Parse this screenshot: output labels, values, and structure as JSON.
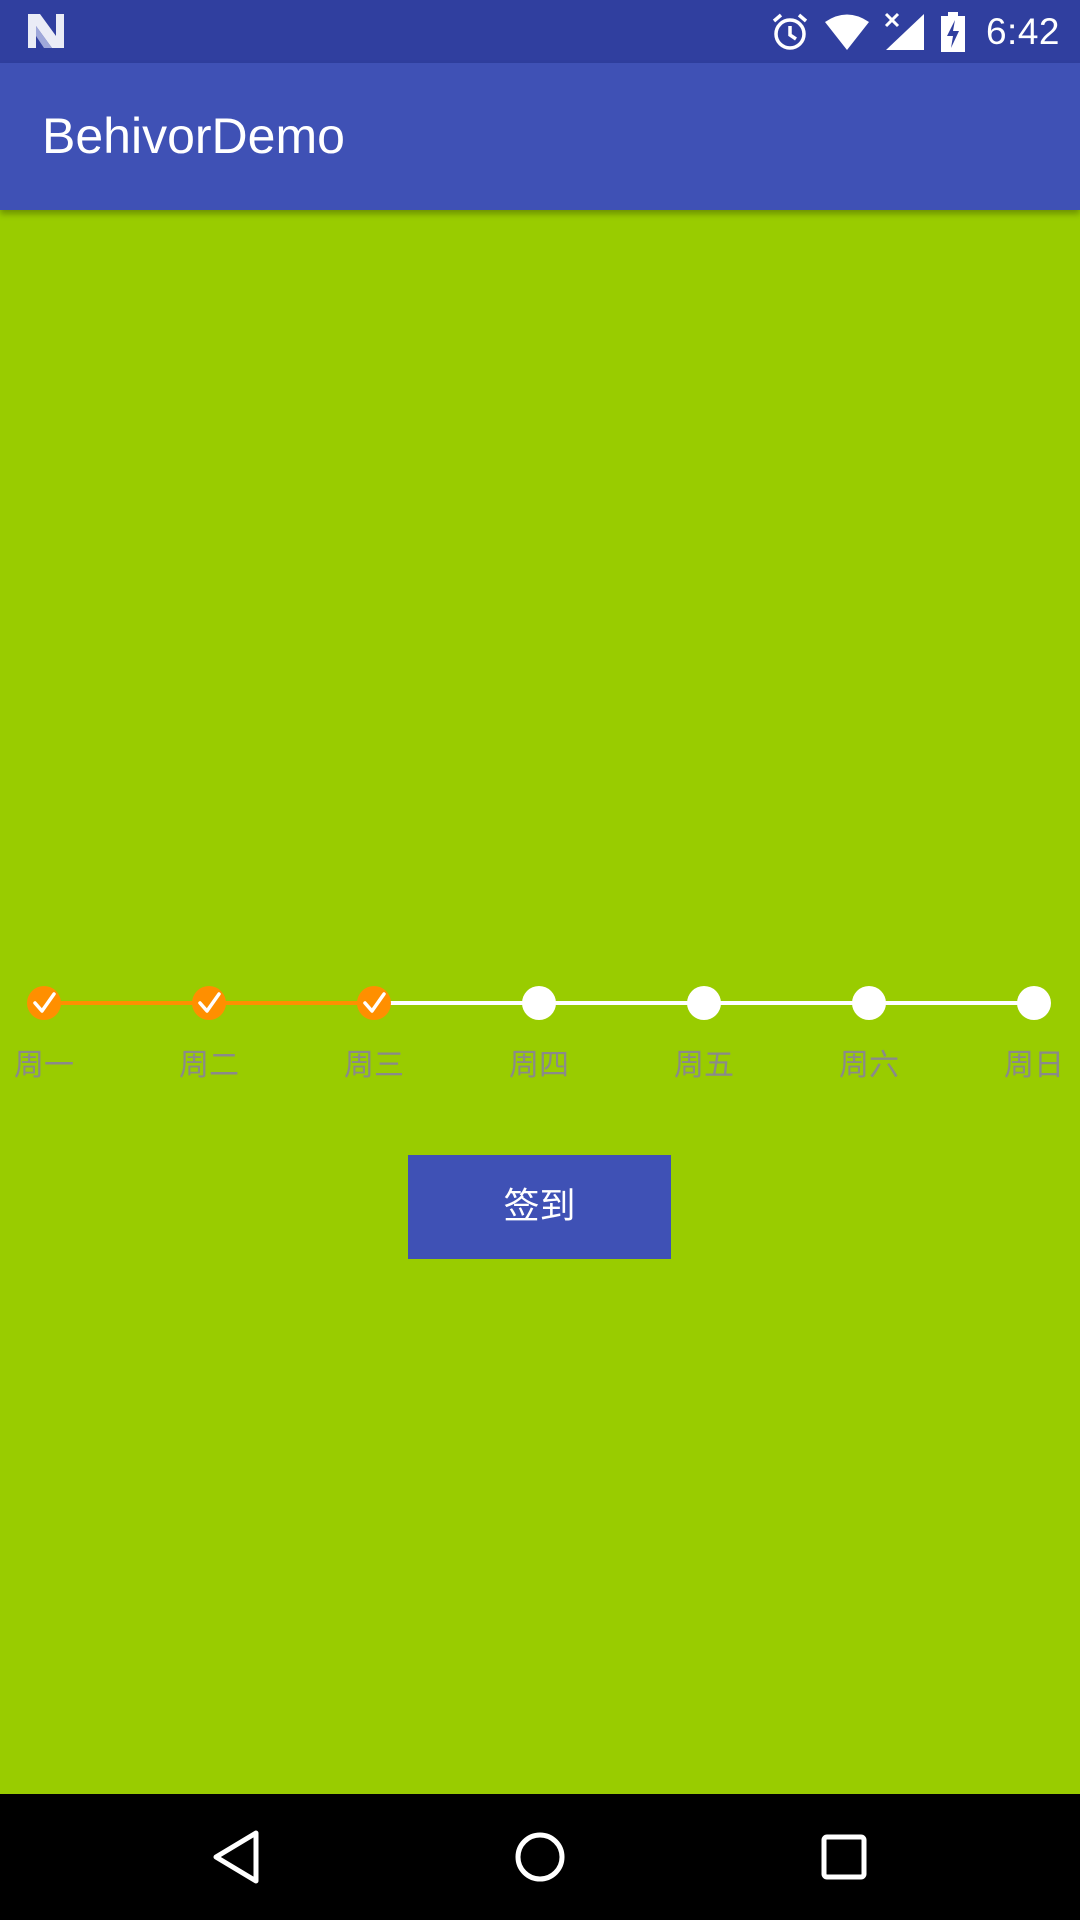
{
  "status_bar": {
    "time": "6:42",
    "icons": [
      "android-n-icon",
      "alarm-icon",
      "wifi-icon",
      "signal-icon",
      "battery-charging-icon"
    ]
  },
  "app_bar": {
    "title": "BehivorDemo",
    "background": "#3f51b5"
  },
  "content": {
    "background": "#99cc00"
  },
  "stepper": {
    "completed_color": "#ff8f00",
    "pending_color": "#ffffff",
    "label_color": "#8a8a8a",
    "completed_count": 3,
    "steps": [
      {
        "label": "周一",
        "done": true
      },
      {
        "label": "周二",
        "done": true
      },
      {
        "label": "周三",
        "done": true
      },
      {
        "label": "周四",
        "done": false
      },
      {
        "label": "周五",
        "done": false
      },
      {
        "label": "周六",
        "done": false
      },
      {
        "label": "周日",
        "done": false
      }
    ]
  },
  "signin_button": {
    "label": "签到"
  },
  "nav_bar": {
    "icons": [
      "back-icon",
      "home-icon",
      "recents-icon"
    ]
  }
}
